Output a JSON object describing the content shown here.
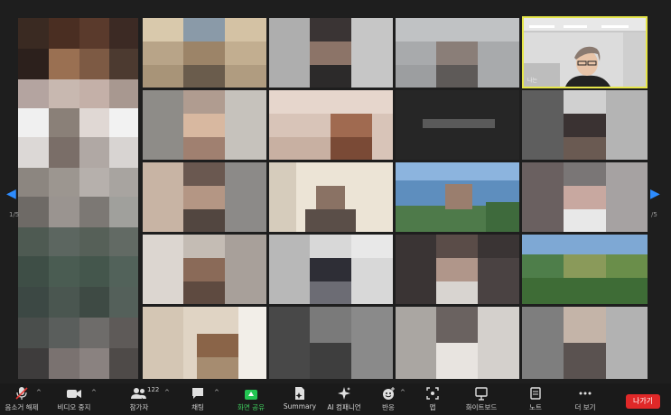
{
  "navigation": {
    "left_page": "1/5",
    "right_page": "/5"
  },
  "speaker_tile": {
    "tag": "나는"
  },
  "toolbar": {
    "unmute": "음소거 해제",
    "video_stop": "비디오 중지",
    "participants": "참가자",
    "participants_count": "122",
    "chat": "채팅",
    "share_screen": "화면 공유",
    "summary": "Summary",
    "ai_companion": "AI 컴패니언",
    "reactions": "반응",
    "apps": "앱",
    "whiteboard": "화이트보드",
    "notes": "노트",
    "more": "더 보기",
    "leave": "나가기"
  },
  "colors": {
    "active_speaker_border": "#e6e64a",
    "share_green": "#23c552",
    "leave_red": "#e02828",
    "nav_blue": "#2d8cff"
  }
}
